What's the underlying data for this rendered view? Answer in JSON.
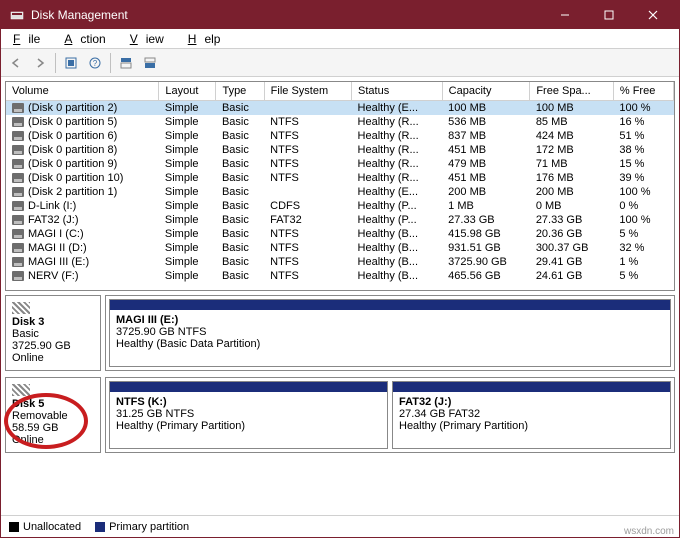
{
  "window": {
    "title": "Disk Management"
  },
  "menu": {
    "file": "File",
    "action": "Action",
    "view": "View",
    "help": "Help"
  },
  "columns": [
    "Volume",
    "Layout",
    "Type",
    "File System",
    "Status",
    "Capacity",
    "Free Spa...",
    "% Free"
  ],
  "rows": [
    {
      "v": "(Disk 0 partition 2)",
      "l": "Simple",
      "t": "Basic",
      "fs": "",
      "s": "Healthy (E...",
      "c": "100 MB",
      "f": "100 MB",
      "p": "100 %",
      "sel": true
    },
    {
      "v": "(Disk 0 partition 5)",
      "l": "Simple",
      "t": "Basic",
      "fs": "NTFS",
      "s": "Healthy (R...",
      "c": "536 MB",
      "f": "85 MB",
      "p": "16 %"
    },
    {
      "v": "(Disk 0 partition 6)",
      "l": "Simple",
      "t": "Basic",
      "fs": "NTFS",
      "s": "Healthy (R...",
      "c": "837 MB",
      "f": "424 MB",
      "p": "51 %"
    },
    {
      "v": "(Disk 0 partition 8)",
      "l": "Simple",
      "t": "Basic",
      "fs": "NTFS",
      "s": "Healthy (R...",
      "c": "451 MB",
      "f": "172 MB",
      "p": "38 %"
    },
    {
      "v": "(Disk 0 partition 9)",
      "l": "Simple",
      "t": "Basic",
      "fs": "NTFS",
      "s": "Healthy (R...",
      "c": "479 MB",
      "f": "71 MB",
      "p": "15 %"
    },
    {
      "v": "(Disk 0 partition 10)",
      "l": "Simple",
      "t": "Basic",
      "fs": "NTFS",
      "s": "Healthy (R...",
      "c": "451 MB",
      "f": "176 MB",
      "p": "39 %"
    },
    {
      "v": "(Disk 2 partition 1)",
      "l": "Simple",
      "t": "Basic",
      "fs": "",
      "s": "Healthy (E...",
      "c": "200 MB",
      "f": "200 MB",
      "p": "100 %"
    },
    {
      "v": "D-Link (I:)",
      "l": "Simple",
      "t": "Basic",
      "fs": "CDFS",
      "s": "Healthy (P...",
      "c": "1 MB",
      "f": "0 MB",
      "p": "0 %"
    },
    {
      "v": "FAT32 (J:)",
      "l": "Simple",
      "t": "Basic",
      "fs": "FAT32",
      "s": "Healthy (P...",
      "c": "27.33 GB",
      "f": "27.33 GB",
      "p": "100 %"
    },
    {
      "v": "MAGI I (C:)",
      "l": "Simple",
      "t": "Basic",
      "fs": "NTFS",
      "s": "Healthy (B...",
      "c": "415.98 GB",
      "f": "20.36 GB",
      "p": "5 %"
    },
    {
      "v": "MAGI II (D:)",
      "l": "Simple",
      "t": "Basic",
      "fs": "NTFS",
      "s": "Healthy (B...",
      "c": "931.51 GB",
      "f": "300.37 GB",
      "p": "32 %"
    },
    {
      "v": "MAGI III (E:)",
      "l": "Simple",
      "t": "Basic",
      "fs": "NTFS",
      "s": "Healthy (B...",
      "c": "3725.90 GB",
      "f": "29.41 GB",
      "p": "1 %"
    },
    {
      "v": "NERV (F:)",
      "l": "Simple",
      "t": "Basic",
      "fs": "NTFS",
      "s": "Healthy (B...",
      "c": "465.56 GB",
      "f": "24.61 GB",
      "p": "5 %"
    }
  ],
  "disk3": {
    "label": "Disk 3",
    "type": "Basic",
    "size": "3725.90 GB",
    "status": "Online",
    "part": {
      "name": "MAGI III  (E:)",
      "sub": "3725.90 GB NTFS",
      "health": "Healthy (Basic Data Partition)"
    }
  },
  "disk5": {
    "label": "Disk 5",
    "type": "Removable",
    "size": "58.59 GB",
    "status": "Online",
    "part1": {
      "name": "NTFS  (K:)",
      "sub": "31.25 GB NTFS",
      "health": "Healthy (Primary Partition)"
    },
    "part2": {
      "name": "FAT32  (J:)",
      "sub": "27.34 GB FAT32",
      "health": "Healthy (Primary Partition)"
    }
  },
  "legend": {
    "unalloc": "Unallocated",
    "primary": "Primary partition"
  },
  "watermark": "wsxdn.com"
}
